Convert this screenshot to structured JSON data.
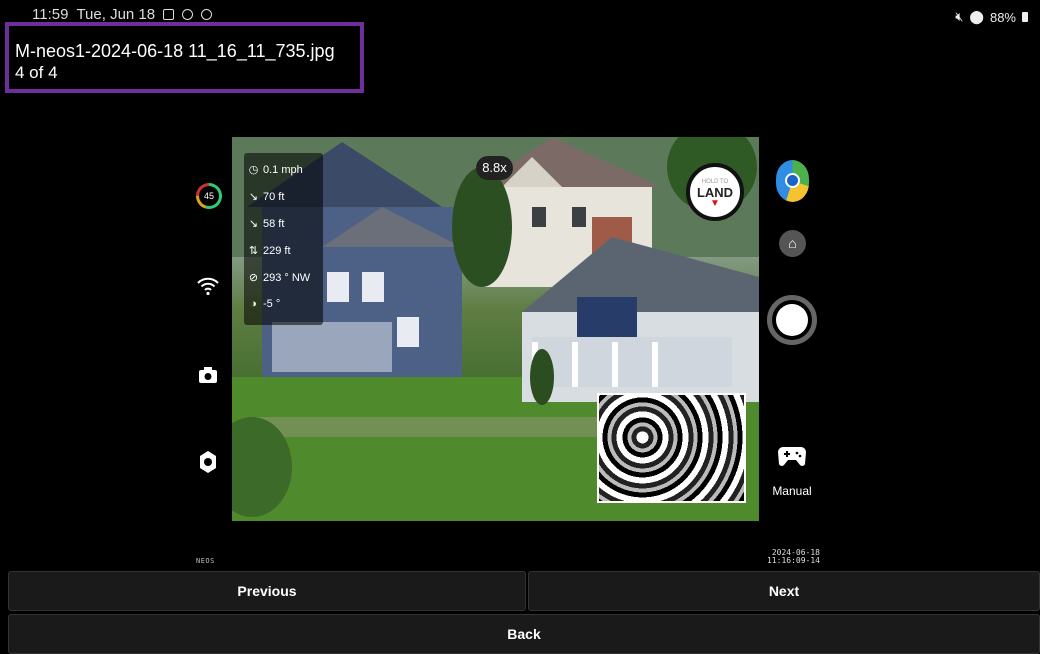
{
  "status_bar": {
    "time": "11:59",
    "date": "Tue, Jun 18",
    "battery": "88%"
  },
  "file": {
    "name": "M-neos1-2024-06-18 11_16_11_735.jpg",
    "position": "4 of 4"
  },
  "accent_color": "#6e2f9c",
  "drone_hud": {
    "battery_level": "45",
    "zoom": "8.8x",
    "telemetry": [
      {
        "icon": "speed-icon",
        "value": "0.1 mph"
      },
      {
        "icon": "distance-icon",
        "value": "70 ft"
      },
      {
        "icon": "horizontal-distance-icon",
        "value": "58 ft"
      },
      {
        "icon": "altitude-icon",
        "value": "229 ft"
      },
      {
        "icon": "compass-icon",
        "value": "293 ° NW"
      },
      {
        "icon": "gimbal-icon",
        "value": "-5 °"
      }
    ],
    "land_button": {
      "small": "HOLD TO",
      "label": "LAND"
    },
    "mode_label": "Manual",
    "brand": "NEOS",
    "timestamp_date": "2024-06-18",
    "timestamp_time": "11:16:09-14"
  },
  "nav": {
    "previous": "Previous",
    "next": "Next",
    "back": "Back"
  }
}
